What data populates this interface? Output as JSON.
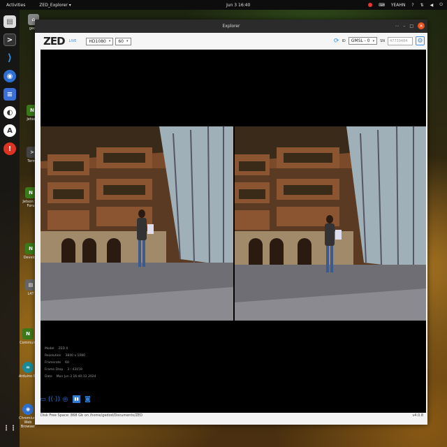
{
  "topbar": {
    "activities": "Activities",
    "app_name": "ZED_Explorer",
    "clock": "Jun 3 16:40",
    "user": "YEAHN"
  },
  "dock": {
    "items": [
      "files",
      "terminal",
      "vscode",
      "chromium",
      "text-editor",
      "ubuntu-software",
      "help",
      "app-grid"
    ]
  },
  "desktop": {
    "icons": [
      {
        "label": "gedo"
      },
      {
        "label": "Jetson"
      },
      {
        "label": "Termi"
      },
      {
        "label": "Jetson Se Foru"
      },
      {
        "label": "Develop"
      },
      {
        "label": "L4T"
      },
      {
        "label": "Communi"
      },
      {
        "label": "Arduino ID"
      },
      {
        "label": "Chromium Web Browser"
      }
    ]
  },
  "window": {
    "title": "Explorer",
    "toolbar": {
      "logo": "ZED",
      "live": "LIVE",
      "resolution": "HD1080",
      "fps": "60",
      "id_label": "ID",
      "id_value": "GMSL - 0",
      "sn_label": "SN",
      "sn_value": "47739484"
    },
    "info": {
      "model": {
        "label": "Model",
        "value": "ZED X"
      },
      "resolution": {
        "label": "Resolution",
        "value": "3840 x 1080"
      },
      "framerate": {
        "label": "Framerate",
        "value": "60"
      },
      "frame_drop": {
        "label": "Frame Drop",
        "value": "3 : 43159"
      },
      "date": {
        "label": "Date",
        "value": "Mon Jun 3 16:40:12 2024"
      }
    },
    "status": {
      "disk": "Disk Free Space: 868 Gb   on /home/gedod/Documents/ZED",
      "version": "v4.0.8"
    }
  }
}
